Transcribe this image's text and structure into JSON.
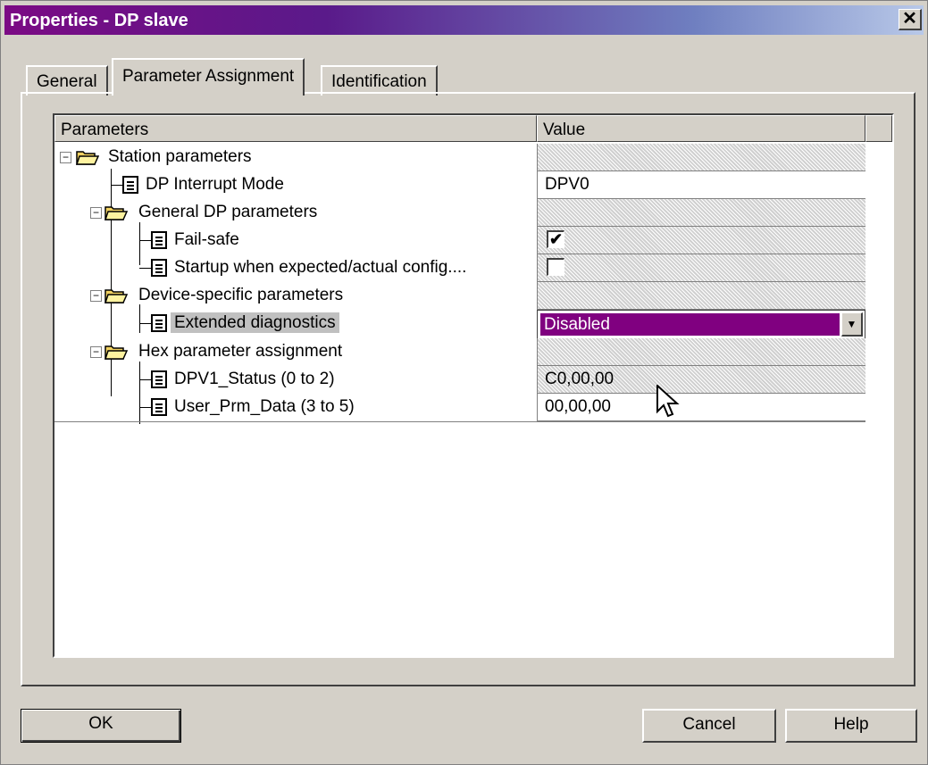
{
  "window": {
    "title": "Properties - DP slave",
    "close_glyph": "✕"
  },
  "tabs": [
    {
      "label": "General"
    },
    {
      "label": "Parameter Assignment"
    },
    {
      "label": "Identification"
    }
  ],
  "grid": {
    "col_parameters": "Parameters",
    "col_value": "Value",
    "rows": [
      {
        "label": "Station parameters",
        "value": ""
      },
      {
        "label": "DP Interrupt Mode",
        "value": "DPV0"
      },
      {
        "label": "General DP parameters",
        "value": ""
      },
      {
        "label": "Fail-safe",
        "value": "",
        "checked": true
      },
      {
        "label": "Startup when expected/actual config....",
        "value": "",
        "checked": false
      },
      {
        "label": "Device-specific parameters",
        "value": ""
      },
      {
        "label": "Extended diagnostics",
        "value": "Disabled"
      },
      {
        "label": "Hex parameter assignment",
        "value": ""
      },
      {
        "label": "DPV1_Status (0 to 2)",
        "value": "C0,00,00"
      },
      {
        "label": "User_Prm_Data (3 to 5)",
        "value": "00,00,00"
      }
    ]
  },
  "buttons": {
    "ok": "OK",
    "cancel": "Cancel",
    "help": "Help"
  },
  "colors": {
    "selection": "#800080",
    "title_start": "#7b0a84",
    "title_end": "#b8c8e8"
  }
}
